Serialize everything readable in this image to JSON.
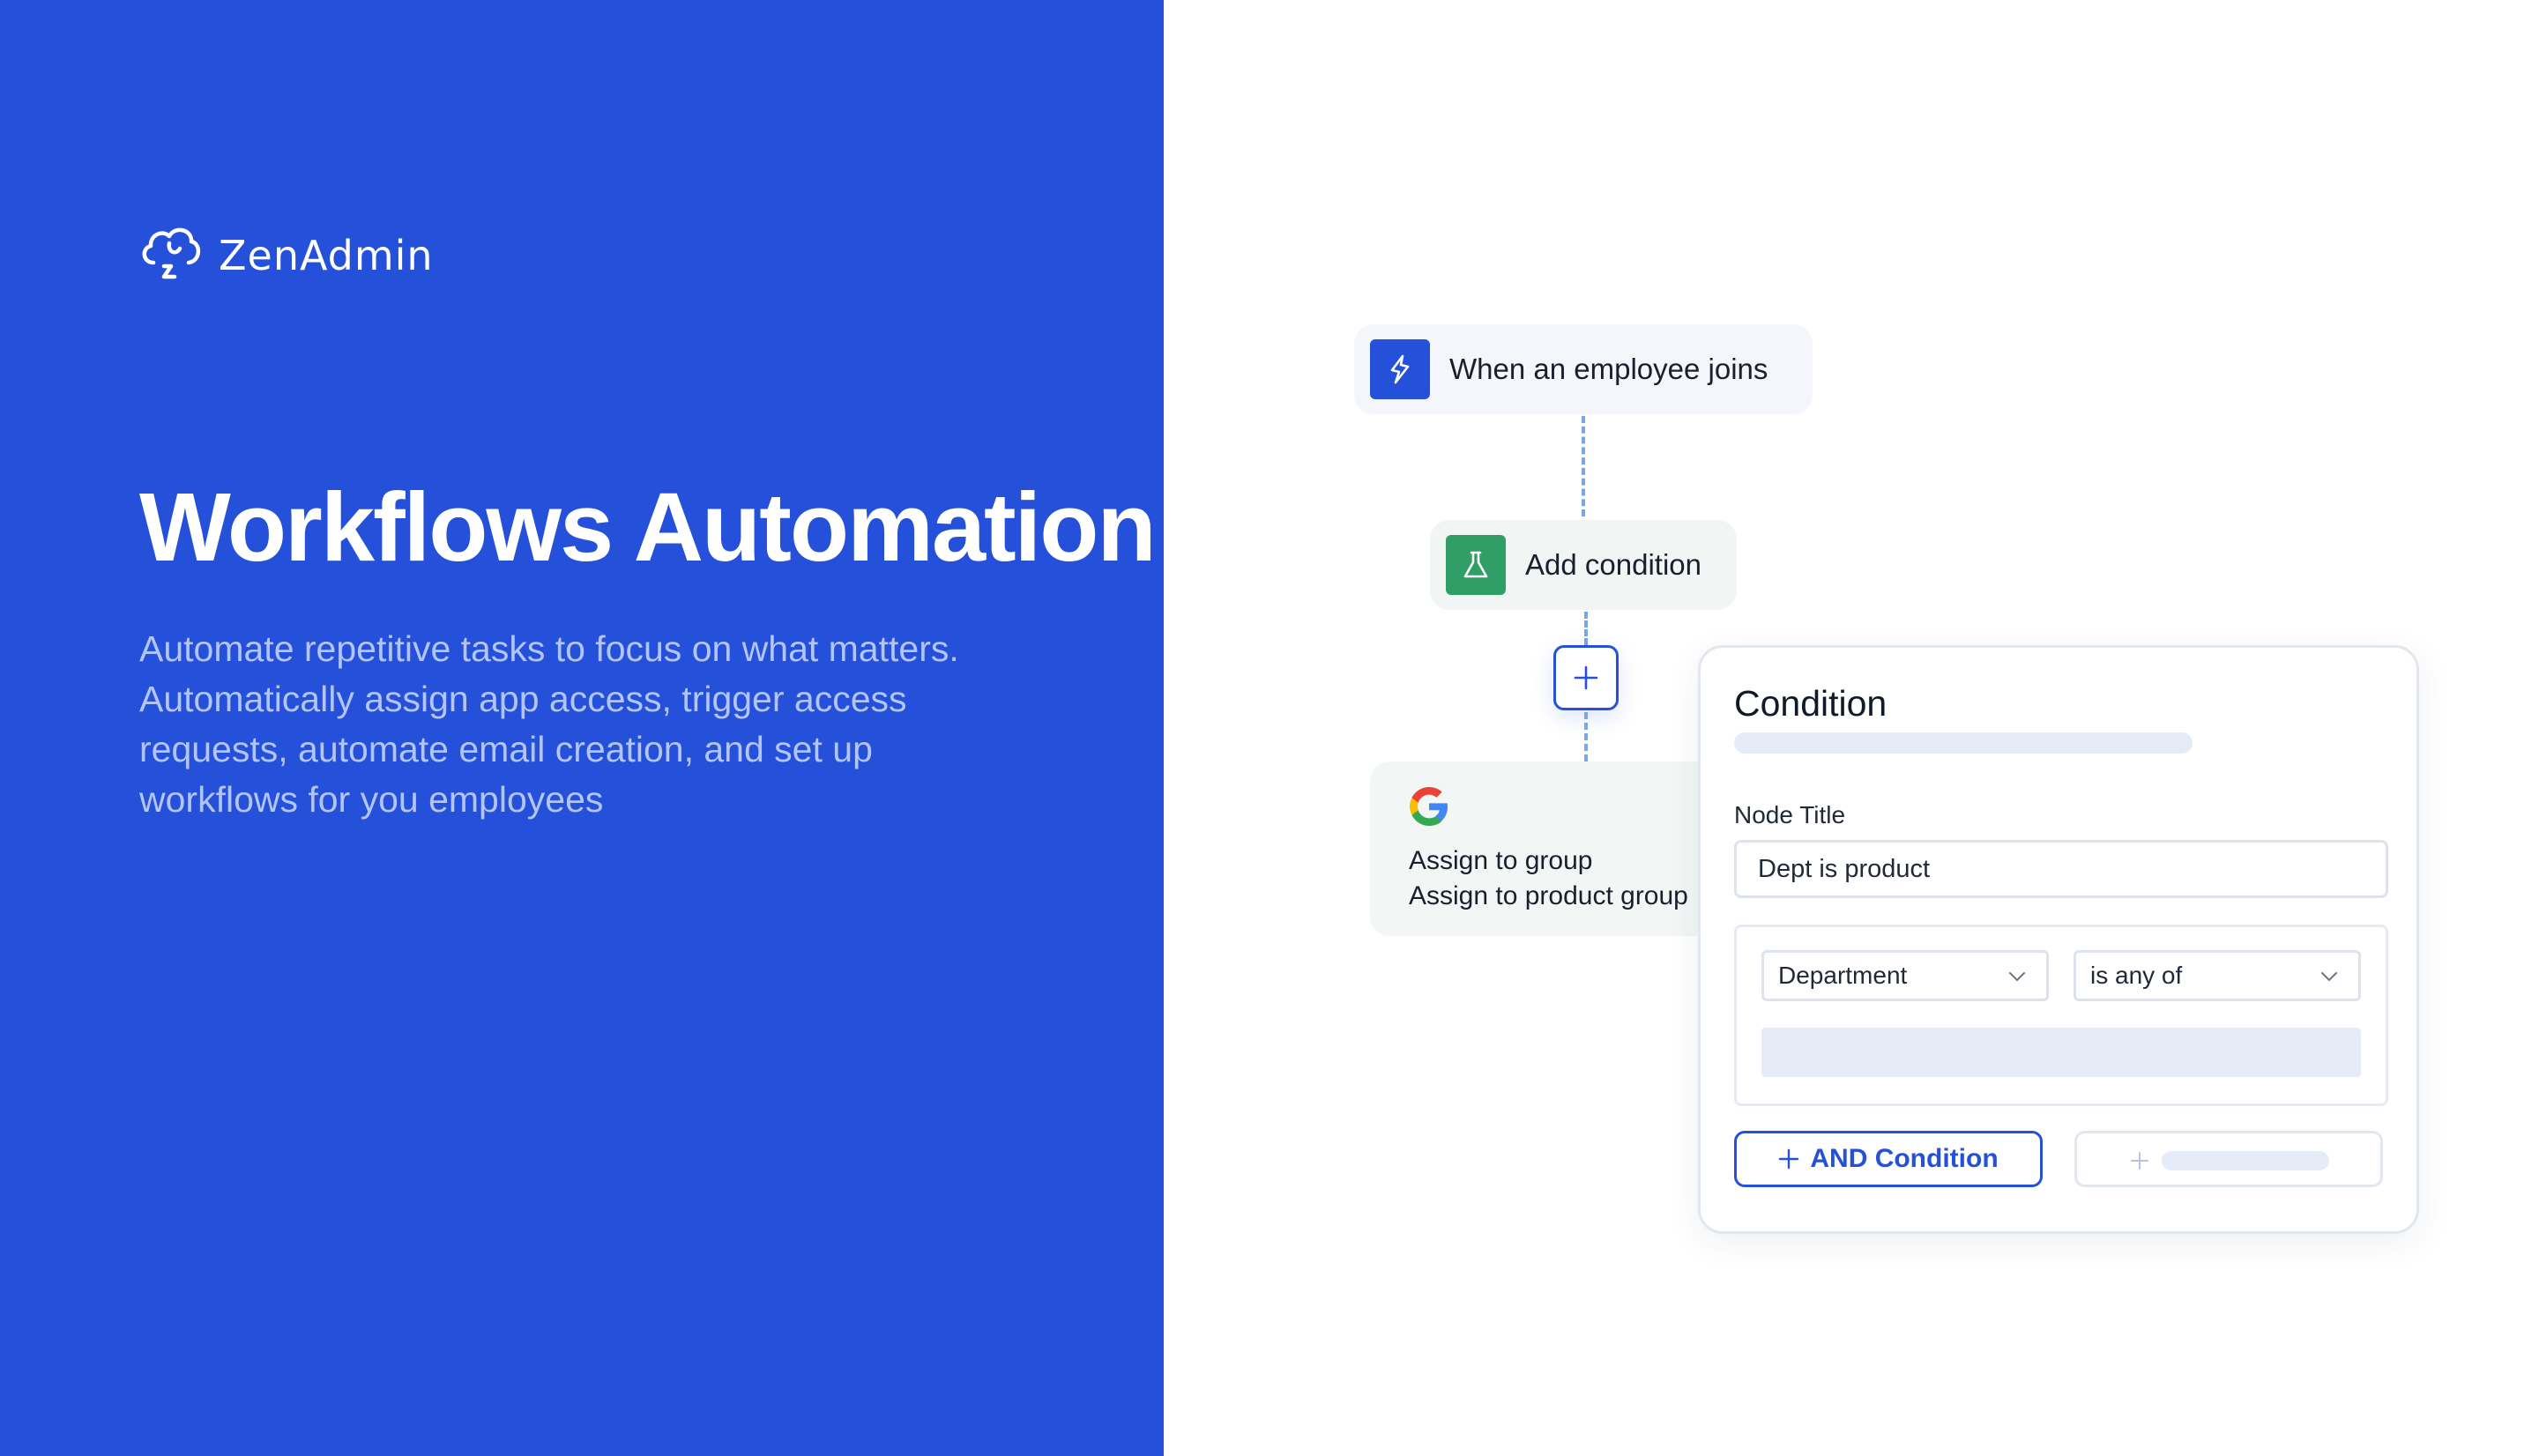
{
  "brand": {
    "name": "ZenAdmin",
    "logo_icon": "cloud-logo-icon",
    "panel_color": "#2550d9"
  },
  "hero": {
    "title": "Workflows Automation",
    "description": "Automate repetitive tasks to focus on what matters. Automatically assign app access, trigger access requests, automate email creation, and set up workflows for you employees"
  },
  "workflow": {
    "trigger": {
      "label": "When an employee joins",
      "icon": "lightning-icon",
      "icon_color": "#2550d9"
    },
    "condition_node": {
      "label": "Add condition",
      "icon": "flask-icon",
      "icon_color": "#2f9e67"
    },
    "add_step_icon": "plus-icon",
    "action": {
      "app_icon": "google-icon",
      "line1": "Assign to group",
      "line2": "Assign to product group"
    }
  },
  "condition_panel": {
    "title": "Condition",
    "node_title_label": "Node Title",
    "node_title_value": "Dept is product",
    "field_select": "Department",
    "operator_select": "is any of",
    "and_button": "AND Condition"
  }
}
